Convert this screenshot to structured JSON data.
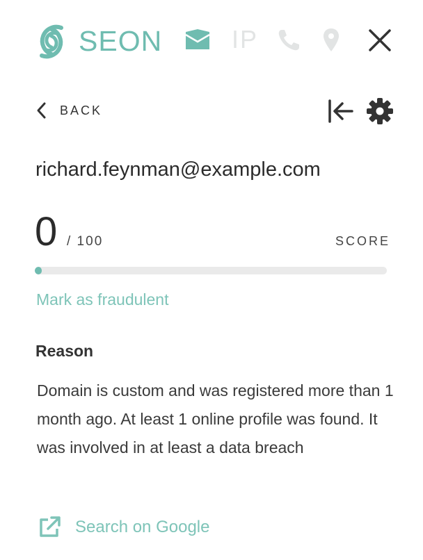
{
  "header": {
    "brand": "SEON",
    "ip_tab": "IP",
    "icons": [
      "seon-logo-icon",
      "mail-icon",
      "phone-icon",
      "location-pin-icon",
      "close-icon"
    ],
    "active_tab_color": "#6fbcb0",
    "inactive_tab_color": "#e2e4e4"
  },
  "nav": {
    "back_label": "BACK",
    "icons": [
      "chevron-left-icon",
      "collapse-panel-icon",
      "gear-icon"
    ]
  },
  "email": "richard.feynman@example.com",
  "score": {
    "value": "0",
    "max_label": "/ 100",
    "label": "SCORE",
    "fraction": 0
  },
  "actions": {
    "mark_fraudulent": "Mark as fraudulent",
    "search_google": "Search on Google"
  },
  "reason": {
    "title": "Reason",
    "text": "Domain is custom and was registered more than 1 month ago. At least 1 online profile was found. It was involved in at least a data breach"
  },
  "colors": {
    "accent": "#6fbcb0",
    "link": "#7ec4b8",
    "bar_track": "#eaeaea"
  }
}
